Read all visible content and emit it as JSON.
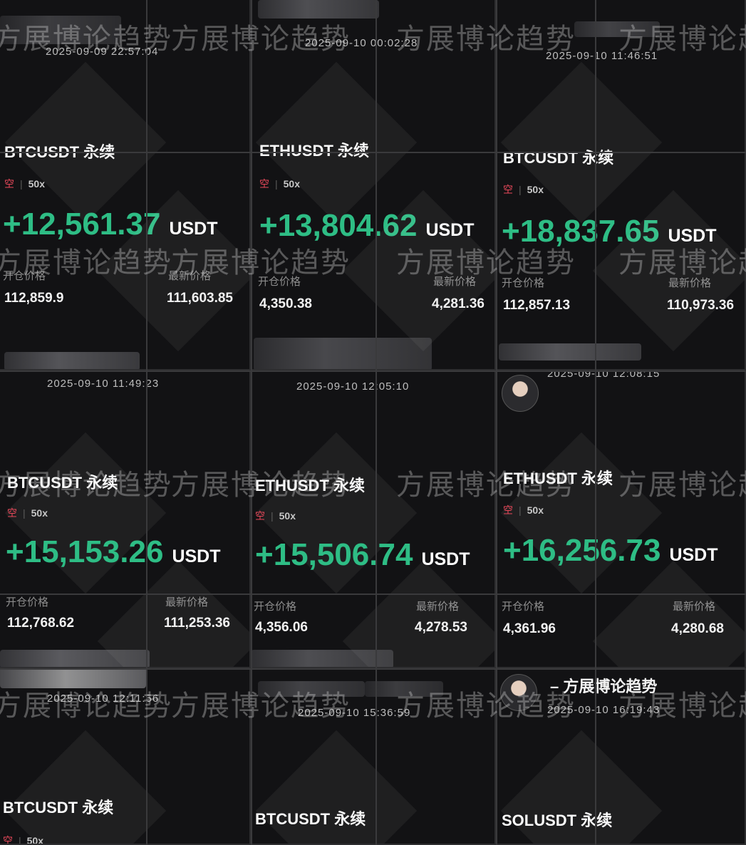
{
  "side": "空",
  "leverage": "50x",
  "unit": "USDT",
  "open_label": "开仓价格",
  "last_label": "最新价格",
  "watermark": "方展博论趋势",
  "cards": [
    {
      "time": "2025-09-09 22:57:04",
      "symbol": "BTCUSDT 永续",
      "pnl": "+12,561.37",
      "open": "112,859.9",
      "last": "111,603.85"
    },
    {
      "time": "2025-09-10 00:02:28",
      "symbol": "ETHUSDT 永续",
      "pnl": "+13,804.62",
      "open": "4,350.38",
      "last": "4,281.36"
    },
    {
      "time": "2025-09-10 11:46:51",
      "symbol": "BTCUSDT 永续",
      "pnl": "+18,837.65",
      "open": "112,857.13",
      "last": "110,973.36"
    },
    {
      "time": "2025-09-10 11:49:23",
      "symbol": "BTCUSDT 永续",
      "pnl": "+15,153.26",
      "open": "112,768.62",
      "last": "111,253.36"
    },
    {
      "time": "2025-09-10 12:05:10",
      "symbol": "ETHUSDT 永续",
      "pnl": "+15,506.74",
      "open": "4,356.06",
      "last": "4,278.53"
    },
    {
      "time": "2025-09-10 12:08:15",
      "symbol": "ETHUSDT 永续",
      "pnl": "+16,256.73",
      "open": "4,361.96",
      "last": "4,280.68"
    },
    {
      "time": "2025-09-10 12:11:56",
      "symbol": "BTCUSDT 永续"
    },
    {
      "time": "2025-09-10 15:36:59",
      "symbol": "BTCUSDT 永续"
    },
    {
      "time": "2025-09-10 16:19:43",
      "symbol": "SOLUSDT 永续",
      "username": "– 方展博论趋势"
    }
  ]
}
